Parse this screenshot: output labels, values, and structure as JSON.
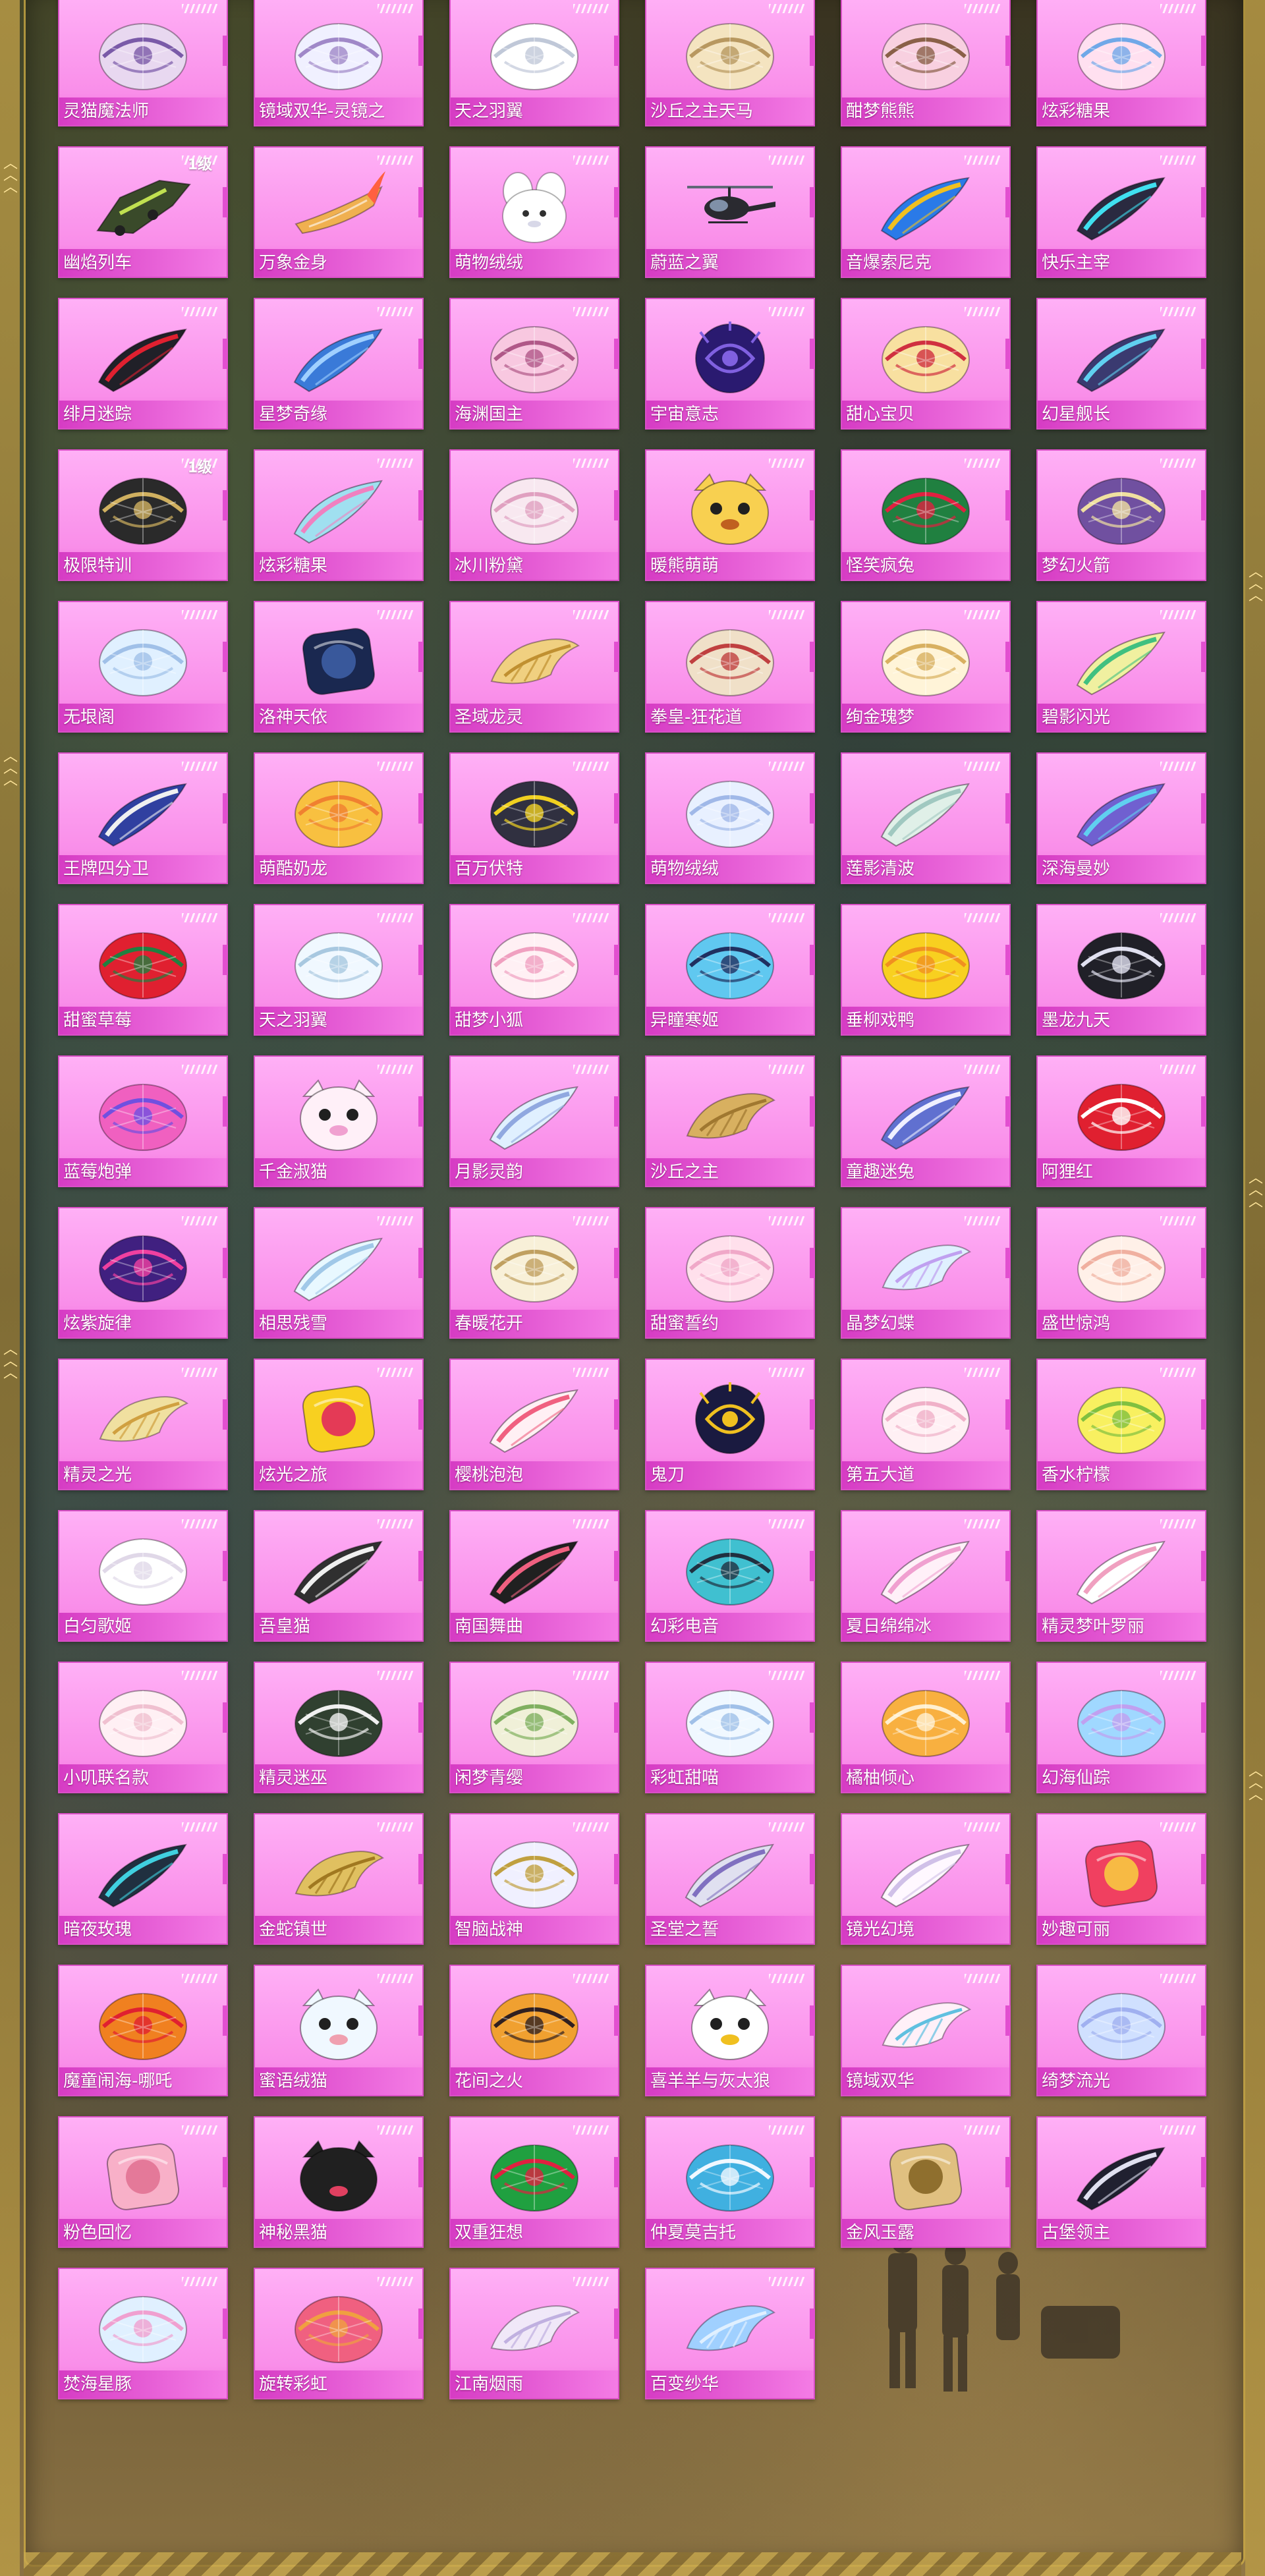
{
  "items": [
    {
      "name": "灵猫魔法师",
      "shape": "para",
      "c1": "#e8d8f0",
      "c2": "#7a5aa8",
      "level": ""
    },
    {
      "name": "镜域双华-灵镜之",
      "shape": "para",
      "c1": "#f0f0ff",
      "c2": "#a088c8",
      "level": ""
    },
    {
      "name": "天之羽翼",
      "shape": "para",
      "c1": "#ffffff",
      "c2": "#c0c8d8",
      "level": ""
    },
    {
      "name": "沙丘之主天马",
      "shape": "para",
      "c1": "#f4e4c0",
      "c2": "#b89860",
      "level": ""
    },
    {
      "name": "酣梦熊熊",
      "shape": "para",
      "c1": "#f8d0e0",
      "c2": "#8a6048",
      "level": ""
    },
    {
      "name": "炫彩糖果",
      "shape": "para",
      "c1": "#ffe0f0",
      "c2": "#70a8e8",
      "level": ""
    },
    {
      "name": "幽焰列车",
      "shape": "vehicle",
      "c1": "#3a4a2a",
      "c2": "#c0e050",
      "level": "1级"
    },
    {
      "name": "万象金身",
      "shape": "rocket",
      "c1": "#f0b050",
      "c2": "#ff6040",
      "level": ""
    },
    {
      "name": "萌物绒绒",
      "shape": "plush",
      "c1": "#ffffff",
      "c2": "#d8d8e8",
      "level": ""
    },
    {
      "name": "蔚蓝之翼",
      "shape": "heli",
      "c1": "#2a2a30",
      "c2": "#606878",
      "level": ""
    },
    {
      "name": "音爆索尼克",
      "shape": "glider",
      "c1": "#2a7ae8",
      "c2": "#f0c020",
      "level": ""
    },
    {
      "name": "快乐主宰",
      "shape": "glider",
      "c1": "#2a2a40",
      "c2": "#40e0f0",
      "level": ""
    },
    {
      "name": "绯月迷踪",
      "shape": "glider",
      "c1": "#202028",
      "c2": "#e02030",
      "level": ""
    },
    {
      "name": "星梦奇缘",
      "shape": "glider",
      "c1": "#3a7ad8",
      "c2": "#a0d0ff",
      "level": ""
    },
    {
      "name": "海渊国主",
      "shape": "para",
      "c1": "#f8c8e0",
      "c2": "#b05888",
      "level": ""
    },
    {
      "name": "宇宙意志",
      "shape": "orb",
      "c1": "#2a1a70",
      "c2": "#8060e0",
      "level": ""
    },
    {
      "name": "甜心宝贝",
      "shape": "para",
      "c1": "#f8e0a0",
      "c2": "#d03040",
      "level": ""
    },
    {
      "name": "幻星舰长",
      "shape": "glider",
      "c1": "#3a3a70",
      "c2": "#60d0f0",
      "level": ""
    },
    {
      "name": "极限特训",
      "shape": "para",
      "c1": "#2a2a2a",
      "c2": "#d0b060",
      "level": "1级"
    },
    {
      "name": "炫彩糖果",
      "shape": "glider",
      "c1": "#a0e0f0",
      "c2": "#f080c0",
      "level": ""
    },
    {
      "name": "冰川粉黛",
      "shape": "para",
      "c1": "#f8e8f0",
      "c2": "#e0a0c0",
      "level": ""
    },
    {
      "name": "暖熊萌萌",
      "shape": "face",
      "c1": "#f8d050",
      "c2": "#c06020",
      "level": ""
    },
    {
      "name": "怪笑疯兔",
      "shape": "para",
      "c1": "#208040",
      "c2": "#e02040",
      "level": ""
    },
    {
      "name": "梦幻火箭",
      "shape": "para",
      "c1": "#7050a0",
      "c2": "#f0e0a0",
      "level": ""
    },
    {
      "name": "无垠阁",
      "shape": "para",
      "c1": "#e0f0ff",
      "c2": "#a0c0e8",
      "level": ""
    },
    {
      "name": "洛神天依",
      "shape": "square",
      "c1": "#1a2850",
      "c2": "#4060a8",
      "level": ""
    },
    {
      "name": "圣域龙灵",
      "shape": "wing",
      "c1": "#f0d080",
      "c2": "#c09030",
      "level": ""
    },
    {
      "name": "拳皇-狂花道",
      "shape": "para",
      "c1": "#f0e0c8",
      "c2": "#c04040",
      "level": ""
    },
    {
      "name": "绚金瑰梦",
      "shape": "para",
      "c1": "#fff4d8",
      "c2": "#d8b060",
      "level": ""
    },
    {
      "name": "碧影闪光",
      "shape": "glider",
      "c1": "#f0f0a0",
      "c2": "#40c080",
      "level": ""
    },
    {
      "name": "王牌四分卫",
      "shape": "glider",
      "c1": "#3040a0",
      "c2": "#f0f0f0",
      "level": ""
    },
    {
      "name": "萌酷奶龙",
      "shape": "para",
      "c1": "#f8c040",
      "c2": "#f08030",
      "level": ""
    },
    {
      "name": "百万伏特",
      "shape": "para",
      "c1": "#303040",
      "c2": "#f0d020",
      "level": ""
    },
    {
      "name": "萌物绒绒",
      "shape": "para",
      "c1": "#e8f0ff",
      "c2": "#a0b8e8",
      "level": ""
    },
    {
      "name": "莲影清波",
      "shape": "glider",
      "c1": "#e0f0e8",
      "c2": "#a0c8c0",
      "level": ""
    },
    {
      "name": "深海曼妙",
      "shape": "glider",
      "c1": "#7060d0",
      "c2": "#60d0f0",
      "level": ""
    },
    {
      "name": "甜蜜草莓",
      "shape": "para",
      "c1": "#e02030",
      "c2": "#208040",
      "level": ""
    },
    {
      "name": "天之羽翼",
      "shape": "para",
      "c1": "#f0f8ff",
      "c2": "#a8c8e0",
      "level": ""
    },
    {
      "name": "甜梦小狐",
      "shape": "para",
      "c1": "#fff0f4",
      "c2": "#f0a0c0",
      "level": ""
    },
    {
      "name": "异瞳寒姬",
      "shape": "para",
      "c1": "#60c8f0",
      "c2": "#203060",
      "level": ""
    },
    {
      "name": "垂柳戏鸭",
      "shape": "para",
      "c1": "#f8d020",
      "c2": "#f09020",
      "level": ""
    },
    {
      "name": "墨龙九天",
      "shape": "para",
      "c1": "#202028",
      "c2": "#e0e0f0",
      "level": ""
    },
    {
      "name": "蓝莓炮弹",
      "shape": "para",
      "c1": "#f060c0",
      "c2": "#7050e0",
      "level": ""
    },
    {
      "name": "千金淑猫",
      "shape": "face",
      "c1": "#fff0f8",
      "c2": "#f0a0d0",
      "level": ""
    },
    {
      "name": "月影灵韵",
      "shape": "glider",
      "c1": "#e0f0ff",
      "c2": "#90a8e0",
      "level": ""
    },
    {
      "name": "沙丘之主",
      "shape": "wing",
      "c1": "#d8b060",
      "c2": "#a07830",
      "level": ""
    },
    {
      "name": "童趣迷兔",
      "shape": "glider",
      "c1": "#6070d0",
      "c2": "#f0f0ff",
      "level": ""
    },
    {
      "name": "阿狸红",
      "shape": "para",
      "c1": "#e02030",
      "c2": "#ffffff",
      "level": ""
    },
    {
      "name": "炫紫旋律",
      "shape": "para",
      "c1": "#402080",
      "c2": "#f040a0",
      "level": ""
    },
    {
      "name": "相思残雪",
      "shape": "glider",
      "c1": "#e8f8ff",
      "c2": "#a0c8e8",
      "level": ""
    },
    {
      "name": "春暖花开",
      "shape": "para",
      "c1": "#f8f0d8",
      "c2": "#c0a060",
      "level": ""
    },
    {
      "name": "甜蜜誓约",
      "shape": "para",
      "c1": "#ffe0ec",
      "c2": "#f0a8c8",
      "level": ""
    },
    {
      "name": "晶梦幻蝶",
      "shape": "wing",
      "c1": "#e0f0ff",
      "c2": "#c0a0f0",
      "level": ""
    },
    {
      "name": "盛世惊鸿",
      "shape": "para",
      "c1": "#fff0e8",
      "c2": "#f0b0a0",
      "level": ""
    },
    {
      "name": "精灵之光",
      "shape": "wing",
      "c1": "#f0e0a0",
      "c2": "#d0a040",
      "level": ""
    },
    {
      "name": "炫光之旅",
      "shape": "square",
      "c1": "#f8d020",
      "c2": "#e02060",
      "level": ""
    },
    {
      "name": "樱桃泡泡",
      "shape": "glider",
      "c1": "#fff0f4",
      "c2": "#f06080",
      "level": ""
    },
    {
      "name": "鬼刀",
      "shape": "orb",
      "c1": "#1a1a40",
      "c2": "#f0c020",
      "level": ""
    },
    {
      "name": "第五大道",
      "shape": "para",
      "c1": "#fff0f4",
      "c2": "#f0b0c8",
      "level": ""
    },
    {
      "name": "香水柠檬",
      "shape": "para",
      "c1": "#f8f060",
      "c2": "#80c040",
      "level": ""
    },
    {
      "name": "白匀歌姬",
      "shape": "para",
      "c1": "#ffffff",
      "c2": "#e0d8e8",
      "level": ""
    },
    {
      "name": "吾皇猫",
      "shape": "glider",
      "c1": "#303030",
      "c2": "#f0f0f0",
      "level": ""
    },
    {
      "name": "南国舞曲",
      "shape": "glider",
      "c1": "#202020",
      "c2": "#f06080",
      "level": ""
    },
    {
      "name": "幻彩电音",
      "shape": "para",
      "c1": "#40c0d0",
      "c2": "#203040",
      "level": ""
    },
    {
      "name": "夏日绵绵冰",
      "shape": "glider",
      "c1": "#fff0f8",
      "c2": "#f0a0d0",
      "level": ""
    },
    {
      "name": "精灵梦叶罗丽",
      "shape": "glider",
      "c1": "#ffffff",
      "c2": "#f0a0c0",
      "level": ""
    },
    {
      "name": "小叽联名款",
      "shape": "para",
      "c1": "#fff0f4",
      "c2": "#f0c0d0",
      "level": ""
    },
    {
      "name": "精灵迷巫",
      "shape": "para",
      "c1": "#304030",
      "c2": "#f0f0f0",
      "level": ""
    },
    {
      "name": "闲梦青缨",
      "shape": "para",
      "c1": "#f0f0d8",
      "c2": "#80b060",
      "level": ""
    },
    {
      "name": "彩虹甜喵",
      "shape": "para",
      "c1": "#f0f8ff",
      "c2": "#a0c0e8",
      "level": ""
    },
    {
      "name": "橘柚倾心",
      "shape": "para",
      "c1": "#f8b040",
      "c2": "#fff0d0",
      "level": ""
    },
    {
      "name": "幻海仙踪",
      "shape": "para",
      "c1": "#a0d8ff",
      "c2": "#c0a0f0",
      "level": ""
    },
    {
      "name": "暗夜玫瑰",
      "shape": "glider",
      "c1": "#203040",
      "c2": "#40d0e0",
      "level": ""
    },
    {
      "name": "金蛇镇世",
      "shape": "wing",
      "c1": "#e0c060",
      "c2": "#a07820",
      "level": ""
    },
    {
      "name": "智脑战神",
      "shape": "para",
      "c1": "#f0f0ff",
      "c2": "#c0a040",
      "level": ""
    },
    {
      "name": "圣堂之誓",
      "shape": "glider",
      "c1": "#e0e0f0",
      "c2": "#8070c0",
      "level": ""
    },
    {
      "name": "镜光幻境",
      "shape": "glider",
      "c1": "#fff8ff",
      "c2": "#d0c0e8",
      "level": ""
    },
    {
      "name": "妙趣可丽",
      "shape": "square",
      "c1": "#f04060",
      "c2": "#f8d040",
      "level": ""
    },
    {
      "name": "魔童闹海-哪吒",
      "shape": "para",
      "c1": "#f08020",
      "c2": "#e02030",
      "level": ""
    },
    {
      "name": "蜜语绒猫",
      "shape": "face",
      "c1": "#f0f8ff",
      "c2": "#f0a0b0",
      "level": ""
    },
    {
      "name": "花间之火",
      "shape": "para",
      "c1": "#f0a030",
      "c2": "#302020",
      "level": ""
    },
    {
      "name": "喜羊羊与灰太狼",
      "shape": "face",
      "c1": "#ffffff",
      "c2": "#f0c020",
      "level": ""
    },
    {
      "name": "镜域双华",
      "shape": "wing",
      "c1": "#fff0f8",
      "c2": "#60c0e0",
      "level": ""
    },
    {
      "name": "绮梦流光",
      "shape": "para",
      "c1": "#d0e0ff",
      "c2": "#a0b0f0",
      "level": ""
    },
    {
      "name": "粉色回忆",
      "shape": "square",
      "c1": "#f8b0c8",
      "c2": "#e07090",
      "level": ""
    },
    {
      "name": "神秘黑猫",
      "shape": "face",
      "c1": "#202020",
      "c2": "#e04060",
      "level": ""
    },
    {
      "name": "双重狂想",
      "shape": "para",
      "c1": "#20a040",
      "c2": "#e02040",
      "level": ""
    },
    {
      "name": "仲夏莫吉托",
      "shape": "para",
      "c1": "#40b0e0",
      "c2": "#f0f8ff",
      "level": ""
    },
    {
      "name": "金风玉露",
      "shape": "square",
      "c1": "#e0c080",
      "c2": "#806020",
      "level": ""
    },
    {
      "name": "古堡领主",
      "shape": "glider",
      "c1": "#202030",
      "c2": "#e0e0f0",
      "level": ""
    },
    {
      "name": "焚海星豚",
      "shape": "para",
      "c1": "#e0f0ff",
      "c2": "#f0a0d0",
      "level": ""
    },
    {
      "name": "旋转彩虹",
      "shape": "para",
      "c1": "#f06080",
      "c2": "#f0a040",
      "level": ""
    },
    {
      "name": "江南烟雨",
      "shape": "wing",
      "c1": "#f0e8f8",
      "c2": "#c0b0e0",
      "level": ""
    },
    {
      "name": "百变纱华",
      "shape": "wing",
      "c1": "#a0d0ff",
      "c2": "#e0f0ff",
      "level": ""
    }
  ]
}
